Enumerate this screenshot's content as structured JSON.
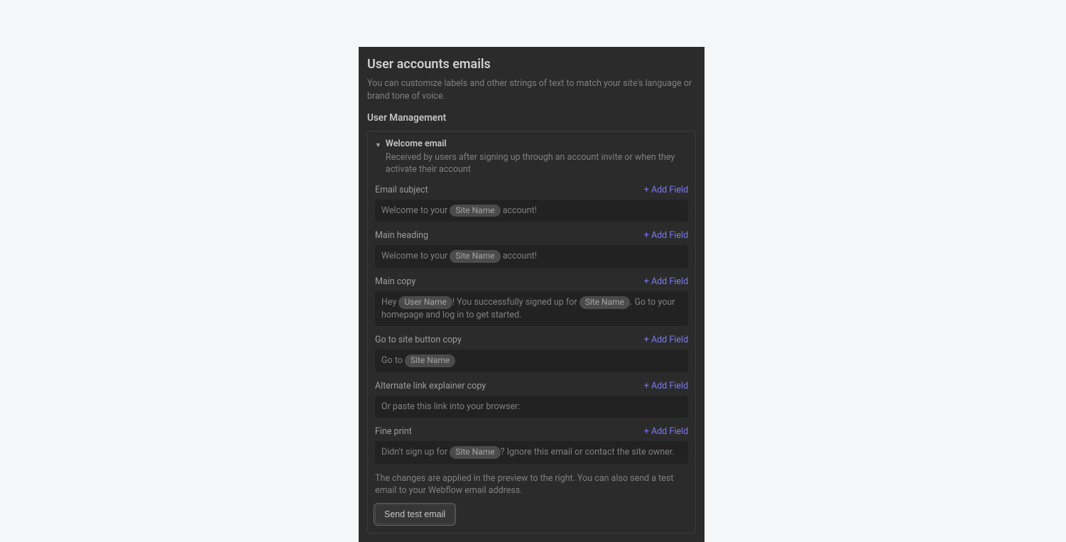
{
  "panel": {
    "title": "User accounts emails",
    "description": "You can customize labels and other strings of text to match your site's language or brand tone of voice.",
    "sectionHeading": "User Management",
    "addFieldLabel": "+ Add Field",
    "previewNote": "The changes are applied in the preview to the right. You can also send a test email to your Webflow email address.",
    "sendTestLabel": "Send test email"
  },
  "card": {
    "title": "Welcome email",
    "subtitle": "Received by users after signing up through an account invite or when they activate their account"
  },
  "tokens": {
    "siteName": "Site Name",
    "userName": "User Name"
  },
  "fields": {
    "emailSubject": {
      "label": "Email subject",
      "prefix": "Welcome to your ",
      "suffix": " account!"
    },
    "mainHeading": {
      "label": "Main heading",
      "prefix": "Welcome to your ",
      "suffix": " account!"
    },
    "mainCopy": {
      "label": "Main copy",
      "part1": "Hey ",
      "part2": "! You successfully signed up for ",
      "part3": ". Go to your homepage and log in to get started."
    },
    "goToSite": {
      "label": "Go to site button copy",
      "prefix": "Go to "
    },
    "altLink": {
      "label": "Alternate link explainer copy",
      "value": "Or paste this link into your browser:"
    },
    "finePrint": {
      "label": "Fine print",
      "prefix": "Didn't sign up for ",
      "suffix": "? Ignore this email or contact the site owner."
    }
  }
}
